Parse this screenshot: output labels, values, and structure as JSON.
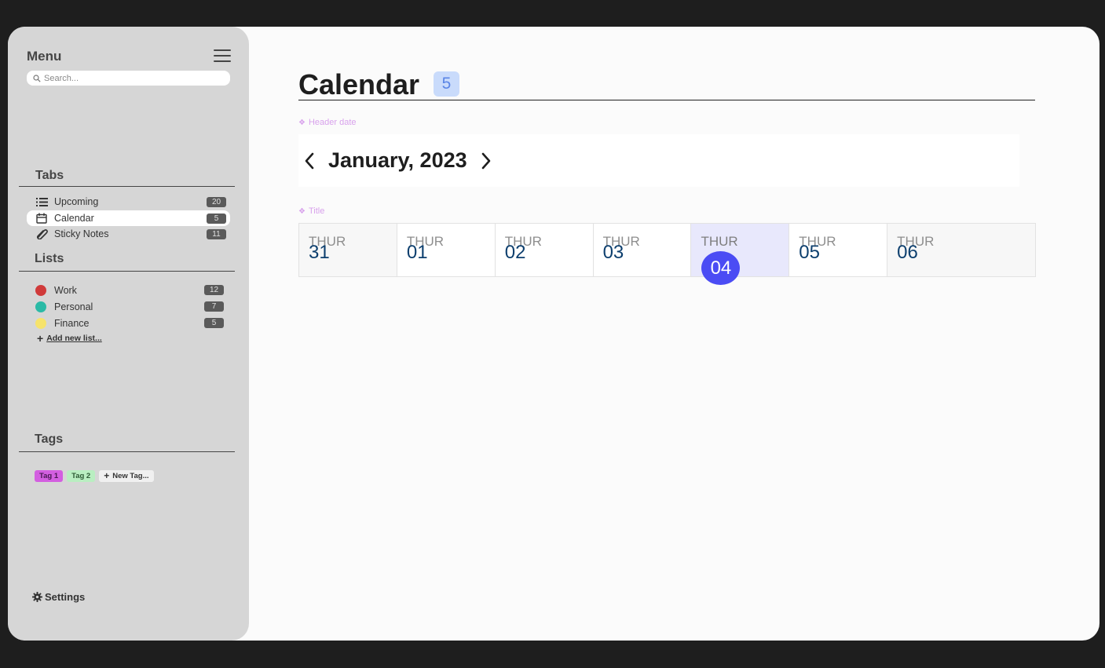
{
  "sidebar": {
    "menu_title": "Menu",
    "search_placeholder": "Search...",
    "tabs_title": "Tabs",
    "tabs": [
      {
        "label": "Upcoming",
        "count": "20",
        "icon": "list-icon"
      },
      {
        "label": "Calendar",
        "count": "5",
        "icon": "calendar-icon",
        "active": true
      },
      {
        "label": "Sticky Notes",
        "count": "11",
        "icon": "paperclip-icon"
      }
    ],
    "lists_title": "Lists",
    "lists": [
      {
        "label": "Work",
        "count": "12",
        "color": "#d03a3a"
      },
      {
        "label": "Personal",
        "count": "7",
        "color": "#2bbaa6"
      },
      {
        "label": "Finance",
        "count": "5",
        "color": "#f6e36c"
      }
    ],
    "add_list_label": "Add new list...",
    "tags_title": "Tags",
    "tags": [
      "Tag 1",
      "Tag 2"
    ],
    "new_tag_label": "New Tag...",
    "settings_label": "Settings"
  },
  "main": {
    "title": "Calendar",
    "badge": "5",
    "header_date_label": "Header date",
    "month_label": "January, 2023",
    "week_label": "Title",
    "days": [
      {
        "name": "THUR",
        "num": "31"
      },
      {
        "name": "THUR",
        "num": "01"
      },
      {
        "name": "THUR",
        "num": "02"
      },
      {
        "name": "THUR",
        "num": "03"
      },
      {
        "name": "THUR",
        "num": "04",
        "selected": true
      },
      {
        "name": "THUR",
        "num": "05"
      },
      {
        "name": "THUR",
        "num": "06"
      }
    ]
  },
  "colors": {
    "accent": "#4b4cf4",
    "badge_bg": "#c9dbfb",
    "sidebar_bg": "#d6d6d6",
    "tag1": "#d35fe0",
    "tag2": "#b9eec1"
  }
}
